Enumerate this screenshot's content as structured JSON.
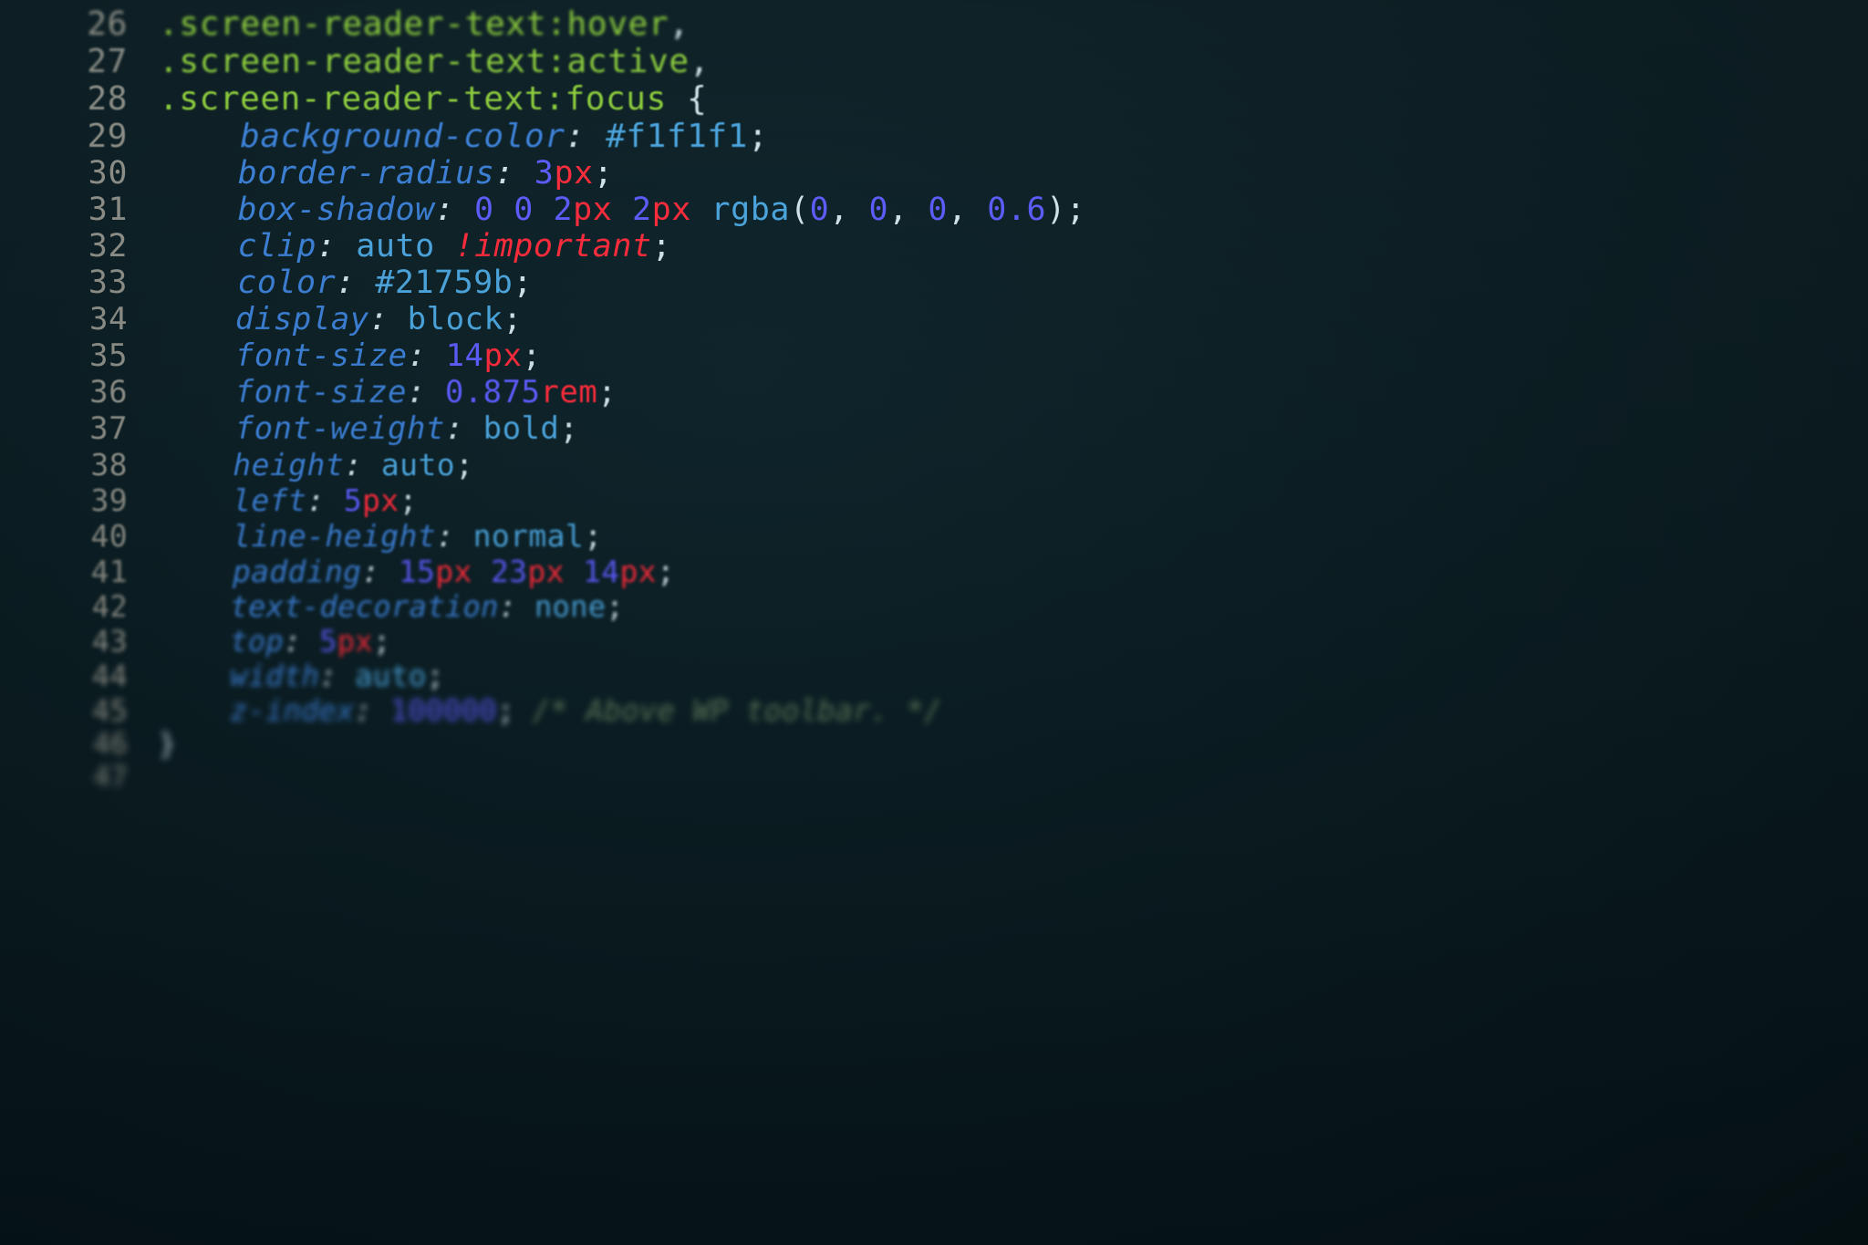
{
  "lines": [
    {
      "num": "26",
      "tokens": [
        {
          "cls": "sel",
          "text": ".screen-reader-text"
        },
        {
          "cls": "pseudo",
          "text": ":hover"
        },
        {
          "cls": "punct",
          "text": ","
        }
      ]
    },
    {
      "num": "27",
      "tokens": [
        {
          "cls": "sel",
          "text": ".screen-reader-text"
        },
        {
          "cls": "pseudo",
          "text": ":active"
        },
        {
          "cls": "punct",
          "text": ","
        }
      ]
    },
    {
      "num": "28",
      "tokens": [
        {
          "cls": "sel",
          "text": ".screen-reader-text"
        },
        {
          "cls": "pseudo",
          "text": ":focus"
        },
        {
          "cls": "space",
          "text": " "
        },
        {
          "cls": "brace",
          "text": "{"
        }
      ]
    },
    {
      "num": "29",
      "indent": 1,
      "tokens": [
        {
          "cls": "prop",
          "text": "background-color"
        },
        {
          "cls": "colon",
          "text": ": "
        },
        {
          "cls": "val",
          "text": "#f1f1f1"
        },
        {
          "cls": "punct",
          "text": ";"
        }
      ]
    },
    {
      "num": "30",
      "indent": 1,
      "tokens": [
        {
          "cls": "prop",
          "text": "border-radius"
        },
        {
          "cls": "colon",
          "text": ": "
        },
        {
          "cls": "num",
          "text": "3"
        },
        {
          "cls": "unit",
          "text": "px"
        },
        {
          "cls": "punct",
          "text": ";"
        }
      ]
    },
    {
      "num": "31",
      "indent": 1,
      "tokens": [
        {
          "cls": "prop",
          "text": "box-shadow"
        },
        {
          "cls": "colon",
          "text": ": "
        },
        {
          "cls": "num",
          "text": "0"
        },
        {
          "cls": "space",
          "text": " "
        },
        {
          "cls": "num",
          "text": "0"
        },
        {
          "cls": "space",
          "text": " "
        },
        {
          "cls": "num",
          "text": "2"
        },
        {
          "cls": "unit",
          "text": "px"
        },
        {
          "cls": "space",
          "text": " "
        },
        {
          "cls": "num",
          "text": "2"
        },
        {
          "cls": "unit",
          "text": "px"
        },
        {
          "cls": "space",
          "text": " "
        },
        {
          "cls": "fn",
          "text": "rgba"
        },
        {
          "cls": "punct",
          "text": "("
        },
        {
          "cls": "num",
          "text": "0"
        },
        {
          "cls": "punct",
          "text": ", "
        },
        {
          "cls": "num",
          "text": "0"
        },
        {
          "cls": "punct",
          "text": ", "
        },
        {
          "cls": "num",
          "text": "0"
        },
        {
          "cls": "punct",
          "text": ", "
        },
        {
          "cls": "num",
          "text": "0.6"
        },
        {
          "cls": "punct",
          "text": ")"
        },
        {
          "cls": "punct",
          "text": ";"
        }
      ]
    },
    {
      "num": "32",
      "indent": 1,
      "tokens": [
        {
          "cls": "prop",
          "text": "clip"
        },
        {
          "cls": "colon",
          "text": ": "
        },
        {
          "cls": "val",
          "text": "auto"
        },
        {
          "cls": "space",
          "text": " "
        },
        {
          "cls": "bang",
          "text": "!important"
        },
        {
          "cls": "punct",
          "text": ";"
        }
      ]
    },
    {
      "num": "33",
      "indent": 1,
      "tokens": [
        {
          "cls": "prop",
          "text": "color"
        },
        {
          "cls": "colon",
          "text": ": "
        },
        {
          "cls": "val",
          "text": "#21759b"
        },
        {
          "cls": "punct",
          "text": ";"
        }
      ]
    },
    {
      "num": "34",
      "indent": 1,
      "tokens": [
        {
          "cls": "prop",
          "text": "display"
        },
        {
          "cls": "colon",
          "text": ": "
        },
        {
          "cls": "val",
          "text": "block"
        },
        {
          "cls": "punct",
          "text": ";"
        }
      ]
    },
    {
      "num": "35",
      "indent": 1,
      "tokens": [
        {
          "cls": "prop",
          "text": "font-size"
        },
        {
          "cls": "colon",
          "text": ": "
        },
        {
          "cls": "num",
          "text": "14"
        },
        {
          "cls": "unit",
          "text": "px"
        },
        {
          "cls": "punct",
          "text": ";"
        }
      ]
    },
    {
      "num": "36",
      "indent": 1,
      "tokens": [
        {
          "cls": "prop",
          "text": "font-size"
        },
        {
          "cls": "colon",
          "text": ": "
        },
        {
          "cls": "num",
          "text": "0.875"
        },
        {
          "cls": "unit",
          "text": "rem"
        },
        {
          "cls": "punct",
          "text": ";"
        }
      ]
    },
    {
      "num": "37",
      "indent": 1,
      "tokens": [
        {
          "cls": "prop",
          "text": "font-weight"
        },
        {
          "cls": "colon",
          "text": ": "
        },
        {
          "cls": "val",
          "text": "bold"
        },
        {
          "cls": "punct",
          "text": ";"
        }
      ]
    },
    {
      "num": "38",
      "indent": 1,
      "tokens": [
        {
          "cls": "prop",
          "text": "height"
        },
        {
          "cls": "colon",
          "text": ": "
        },
        {
          "cls": "val",
          "text": "auto"
        },
        {
          "cls": "punct",
          "text": ";"
        }
      ]
    },
    {
      "num": "39",
      "indent": 1,
      "tokens": [
        {
          "cls": "prop",
          "text": "left"
        },
        {
          "cls": "colon",
          "text": ": "
        },
        {
          "cls": "num",
          "text": "5"
        },
        {
          "cls": "unit",
          "text": "px"
        },
        {
          "cls": "punct",
          "text": ";"
        }
      ]
    },
    {
      "num": "40",
      "indent": 1,
      "tokens": [
        {
          "cls": "prop",
          "text": "line-height"
        },
        {
          "cls": "colon",
          "text": ": "
        },
        {
          "cls": "val",
          "text": "normal"
        },
        {
          "cls": "punct",
          "text": ";"
        }
      ]
    },
    {
      "num": "41",
      "indent": 1,
      "tokens": [
        {
          "cls": "prop",
          "text": "padding"
        },
        {
          "cls": "colon",
          "text": ": "
        },
        {
          "cls": "num",
          "text": "15"
        },
        {
          "cls": "unit",
          "text": "px"
        },
        {
          "cls": "space",
          "text": " "
        },
        {
          "cls": "num",
          "text": "23"
        },
        {
          "cls": "unit",
          "text": "px"
        },
        {
          "cls": "space",
          "text": " "
        },
        {
          "cls": "num",
          "text": "14"
        },
        {
          "cls": "unit",
          "text": "px"
        },
        {
          "cls": "punct",
          "text": ";"
        }
      ]
    },
    {
      "num": "42",
      "indent": 1,
      "tokens": [
        {
          "cls": "prop",
          "text": "text-decoration"
        },
        {
          "cls": "colon",
          "text": ": "
        },
        {
          "cls": "val",
          "text": "none"
        },
        {
          "cls": "punct",
          "text": ";"
        }
      ]
    },
    {
      "num": "43",
      "indent": 1,
      "tokens": [
        {
          "cls": "prop",
          "text": "top"
        },
        {
          "cls": "colon",
          "text": ": "
        },
        {
          "cls": "num",
          "text": "5"
        },
        {
          "cls": "unit",
          "text": "px"
        },
        {
          "cls": "punct",
          "text": ";"
        }
      ]
    },
    {
      "num": "44",
      "indent": 1,
      "tokens": [
        {
          "cls": "prop",
          "text": "width"
        },
        {
          "cls": "colon",
          "text": ": "
        },
        {
          "cls": "val",
          "text": "auto"
        },
        {
          "cls": "punct",
          "text": ";"
        }
      ]
    },
    {
      "num": "45",
      "indent": 1,
      "tokens": [
        {
          "cls": "prop",
          "text": "z-index"
        },
        {
          "cls": "colon",
          "text": ": "
        },
        {
          "cls": "num",
          "text": "100000"
        },
        {
          "cls": "punct",
          "text": ";"
        },
        {
          "cls": "space",
          "text": " "
        },
        {
          "cls": "comment",
          "text": "/* Above WP toolbar. */"
        }
      ]
    },
    {
      "num": "46",
      "tokens": [
        {
          "cls": "brace",
          "text": "}"
        }
      ]
    },
    {
      "num": "47",
      "tokens": []
    }
  ],
  "indent_unit": "    "
}
